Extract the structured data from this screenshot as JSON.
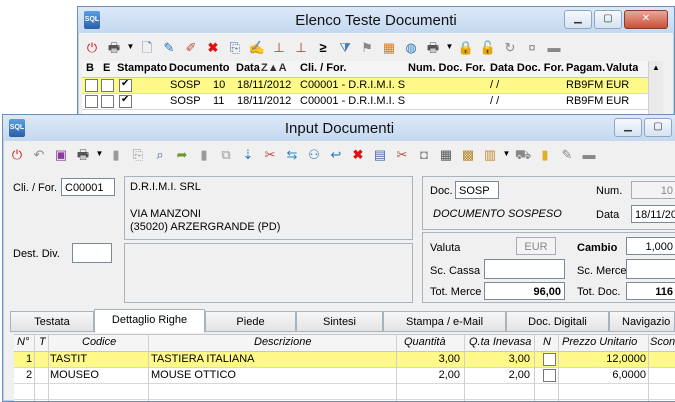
{
  "back_window": {
    "app_icon": "SQL",
    "title": "Elenco Teste Documenti",
    "columns": [
      "B",
      "E",
      "Stampato",
      "Documento",
      "Data",
      "Z▲A",
      "Cli. / For.",
      "Num. Doc. For.",
      "Data Doc. For.",
      "Pagam.",
      "Valuta"
    ],
    "rows": [
      {
        "doc_type": "SOSP",
        "doc_num": "10",
        "date": "18/11/2012",
        "client": "C00001 - D.R.I.M.I. SR",
        "num_doc_for": "",
        "date_doc_for": "/ /",
        "payment": "RB9FM",
        "currency": "EUR",
        "stampato": true
      },
      {
        "doc_type": "SOSP",
        "doc_num": "11",
        "date": "18/11/2012",
        "client": "C00001 - D.R.I.M.I. SR",
        "num_doc_for": "",
        "date_doc_for": "/ /",
        "payment": "RB9FM",
        "currency": "EUR",
        "stampato": true
      }
    ],
    "scroll_up": "▲"
  },
  "front_window": {
    "app_icon": "SQL",
    "title": "Input Documenti",
    "client": {
      "label": "Cli. / For.",
      "code": "C00001",
      "name": "D.R.I.M.I. SRL",
      "street": "VIA MANZONI",
      "city": "(35020)  ARZERGRANDE (PD)"
    },
    "dest_div_label": "Dest. Div.",
    "doc": {
      "doc_label": "Doc.",
      "doc_value": "SOSP",
      "num_label": "Num.",
      "num_value": "10",
      "desc": "DOCUMENTO SOSPESO",
      "data_label": "Data",
      "data_value": "18/11/20"
    },
    "totals": {
      "valuta_label": "Valuta",
      "valuta_value": "EUR",
      "cambio_label": "Cambio",
      "cambio_value": "1,000",
      "sc_cassa_label": "Sc. Cassa",
      "sc_merce_label": "Sc. Merce",
      "tot_merce_label": "Tot. Merce",
      "tot_merce_value": "96,00",
      "tot_doc_label": "Tot. Doc.",
      "tot_doc_value": "116"
    },
    "tabs": [
      "Testata",
      "Dettaglio Righe",
      "Piede",
      "Sintesi",
      "Stampa / e-Mail",
      "Doc. Digitali",
      "Navigazio"
    ],
    "grid": {
      "columns": [
        "N°",
        "T",
        "Codice",
        "Descrizione",
        "Quantità",
        "Q.ta Inevasa",
        "N",
        "Prezzo Unitario",
        "Scon"
      ],
      "rows": [
        {
          "n": "1",
          "code": "TASTIT",
          "desc": "TASTIERA ITALIANA",
          "qty": "3,00",
          "qty_inev": "3,00",
          "price": "12,0000"
        },
        {
          "n": "2",
          "code": "MOUSEO",
          "desc": "MOUSE OTTICO",
          "qty": "2,00",
          "qty_inev": "2,00",
          "price": "6,0000"
        }
      ]
    }
  },
  "icons": {
    "back_toolbar": [
      "power-icon",
      "printer-icon",
      "new-doc-icon",
      "edit-pencil-icon",
      "edit-red-icon",
      "delete-x-icon",
      "copy-doc-icon",
      "form-icon",
      "chart-icon",
      "chart2-icon",
      "greater-equal-icon",
      "filter-icon",
      "flag-icon",
      "grid-color-icon",
      "globe-icon",
      "print2-icon",
      "lock-icon",
      "unlock-icon",
      "refresh-icon",
      "currency-icon",
      "folder-icon"
    ],
    "front_toolbar": [
      "power-icon",
      "back-arrow-icon",
      "save-disk-icon",
      "printer-icon",
      "new-doc-icon",
      "copy-doc-icon",
      "search-doc-icon",
      "open-folder-icon",
      "page-icon",
      "duplicate-icon",
      "down-arrow-icon",
      "tools-icon",
      "exchange-icon",
      "group-icon",
      "return-arrow-icon",
      "delete-x-icon",
      "clipboard-icon",
      "scissors-icon",
      "camera-icon",
      "calculator-icon",
      "box-icon",
      "report-icon",
      "truck-icon",
      "note-icon",
      "pen-icon",
      "folder-icon"
    ]
  }
}
